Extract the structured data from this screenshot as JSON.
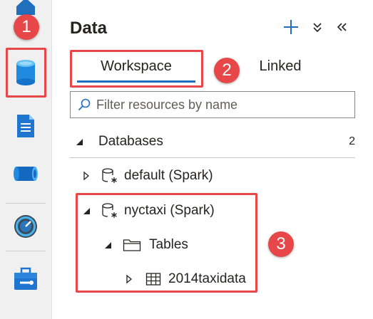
{
  "colors": {
    "accent": "#1f6fbd",
    "callout": "#e8474a",
    "rail_background": "#f0f0f0"
  },
  "rail": {
    "items": [
      {
        "icon": "home-icon"
      },
      {
        "icon": "data-icon",
        "selected": true
      },
      {
        "icon": "develop-icon"
      },
      {
        "icon": "integrate-icon"
      },
      {
        "icon": "monitor-icon"
      },
      {
        "icon": "manage-icon"
      }
    ]
  },
  "callouts": [
    "1",
    "2",
    "3"
  ],
  "panel": {
    "title": "Data",
    "actions": [
      "add-icon",
      "expand-all-icon",
      "collapse-panel-icon"
    ]
  },
  "tabs": [
    {
      "label": "Workspace",
      "selected": true
    },
    {
      "label": "Linked",
      "selected": false
    }
  ],
  "search": {
    "value": "",
    "placeholder": "Filter resources by name"
  },
  "section": {
    "label": "Databases",
    "count": "2",
    "expanded": true
  },
  "tree": [
    {
      "label": "default (Spark)",
      "icon": "spark-database-icon",
      "expanded": false
    },
    {
      "label": "nyctaxi (Spark)",
      "icon": "spark-database-icon",
      "expanded": true
    },
    {
      "label": "Tables",
      "icon": "folder-icon",
      "expanded": true
    },
    {
      "label": "2014taxidata",
      "icon": "table-icon",
      "expanded": false
    }
  ]
}
